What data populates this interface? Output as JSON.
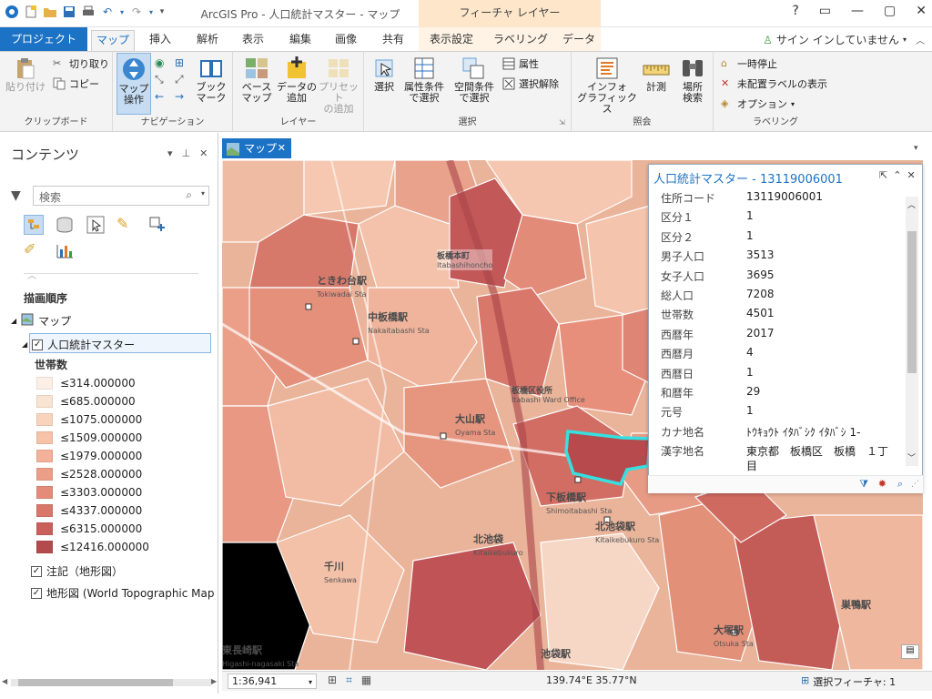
{
  "app": {
    "title": "ArcGIS Pro - 人口統計マスター - マップ",
    "context_tab": "フィーチャ レイヤー",
    "help": "?",
    "signin": "サイン インしていません"
  },
  "tabs": {
    "project": "プロジェクト",
    "items": [
      "マップ",
      "挿入",
      "解析",
      "表示",
      "編集",
      "画像",
      "共有",
      "表示設定",
      "ラベリング",
      "データ"
    ],
    "active": "マップ"
  },
  "ribbon": {
    "clipboard": {
      "label": "クリップボード",
      "paste": "貼り付け",
      "cut": "切り取り",
      "copy": "コピー"
    },
    "navigation": {
      "label": "ナビゲーション",
      "explore": "マップ\n操作",
      "bookmarks": "ブック\nマーク"
    },
    "layer": {
      "label": "レイヤー",
      "basemap": "ベース\nマップ",
      "add_data": "データの\n追加",
      "add_preset": "プリセット\nの追加"
    },
    "selection": {
      "label": "選択",
      "select": "選択",
      "by_attr": "属性条件\nで選択",
      "by_loc": "空間条件\nで選択",
      "attributes": "属性",
      "clear": "選択解除"
    },
    "inquiry": {
      "label": "照会",
      "infographics": "インフォ\nグラフィックス",
      "measure": "計測",
      "locate": "場所\n検索"
    },
    "labeling": {
      "label": "ラベリング",
      "pause": "一時停止",
      "unplaced": "未配置ラベルの表示",
      "options": "オプション"
    }
  },
  "contents": {
    "title": "コンテンツ",
    "search_placeholder": "検索",
    "draw_order": "描画順序",
    "map_node": "マップ",
    "layer": "人口統計マスター",
    "field": "世帯数",
    "legend": [
      {
        "label": "≤314.000000",
        "color": "#fbefe6"
      },
      {
        "label": "≤685.000000",
        "color": "#f9e3d2"
      },
      {
        "label": "≤1075.000000",
        "color": "#f8d4bd"
      },
      {
        "label": "≤1509.000000",
        "color": "#f6c3a8"
      },
      {
        "label": "≤1979.000000",
        "color": "#f2b198"
      },
      {
        "label": "≤2528.000000",
        "color": "#ec9f88"
      },
      {
        "label": "≤3303.000000",
        "color": "#e48c79"
      },
      {
        "label": "≤4337.000000",
        "color": "#d8776a"
      },
      {
        "label": "≤6315.000000",
        "color": "#c9605b"
      },
      {
        "label": "≤12416.000000",
        "color": "#b34a4d"
      }
    ],
    "annotation_layer": "注記（地形図）",
    "basemap_layer": "地形図 (World Topographic Map"
  },
  "map": {
    "tab": "マップ",
    "scale": "1:36,941",
    "coords": "139.74°E 35.77°N",
    "selected": "選択フィーチャ: 1",
    "labels": [
      {
        "t": "ときわ台駅",
        "s": "Tokiwadai Sta"
      },
      {
        "t": "中板橋駅",
        "s": "Nakaitabashi Sta"
      },
      {
        "t": "大山駅",
        "s": "Oyama Sta"
      },
      {
        "t": "下板橋駅",
        "s": "Shimoitabashi Sta"
      },
      {
        "t": "北池袋駅",
        "s": "Kitaikebukuro Sta"
      },
      {
        "t": "北池袋",
        "s": "Kitaikebukuro"
      },
      {
        "t": "千川",
        "s": "Senkawa"
      },
      {
        "t": "東長崎駅",
        "s": "Higashi-nagasaki Sta"
      },
      {
        "t": "大塚駅",
        "s": "Otsuka Sta"
      },
      {
        "t": "巣鴨駅",
        "s": ""
      },
      {
        "t": "池袋駅",
        "s": ""
      },
      {
        "t": "板橋区役所",
        "s": "Itabashi Ward Office"
      },
      {
        "t": "板橋本町",
        "s": "Itabashihoncho"
      }
    ]
  },
  "popup": {
    "title": "人口統計マスター - 13119006001",
    "fields": [
      {
        "k": "住所コード",
        "v": "13119006001"
      },
      {
        "k": "区分１",
        "v": "1"
      },
      {
        "k": "区分２",
        "v": "1"
      },
      {
        "k": "男子人口",
        "v": "3513"
      },
      {
        "k": "女子人口",
        "v": "3695"
      },
      {
        "k": "総人口",
        "v": "7208"
      },
      {
        "k": "世帯数",
        "v": "4501"
      },
      {
        "k": "西暦年",
        "v": "2017"
      },
      {
        "k": "西暦月",
        "v": "4"
      },
      {
        "k": "西暦日",
        "v": "1"
      },
      {
        "k": "和暦年",
        "v": "29"
      },
      {
        "k": "元号",
        "v": "1"
      },
      {
        "k": "カナ地名",
        "v": "ﾄｳｷｮｳﾄ ｲﾀﾊﾞｼｸ ｲﾀﾊﾞｼ 1-"
      },
      {
        "k": "漢字地名",
        "v": "東京都　板橋区　板橋　１丁"
      },
      {
        "k": "",
        "v": "目"
      }
    ]
  }
}
